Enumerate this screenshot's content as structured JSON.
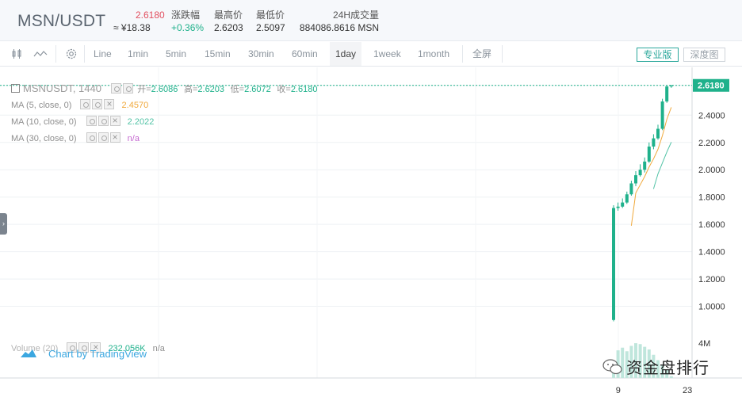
{
  "header": {
    "pair": "MSN/USDT",
    "price": "2.6180",
    "price_cny": "≈ ¥18.38",
    "change_label": "涨跌幅",
    "change_value": "+0.36%",
    "high_label": "最高价",
    "high_value": "2.6203",
    "low_label": "最低价",
    "low_value": "2.5097",
    "volume_label": "24H成交量",
    "volume_value": "884086.8616 MSN"
  },
  "toolbar": {
    "intervals": [
      "Line",
      "1min",
      "5min",
      "15min",
      "30min",
      "60min",
      "1day",
      "1week",
      "1month"
    ],
    "selected_interval": "1day",
    "fullscreen": "全屏",
    "pro_button": "专业版",
    "depth_button": "深度图"
  },
  "legend": {
    "symbol": "MSNUSDT, 1440",
    "open_label": "开=",
    "open": "2.6086",
    "high_label": "高=",
    "high": "2.6203",
    "low_label": "低=",
    "low": "2.6072",
    "close_label": "收=",
    "close": "2.6180",
    "ma5_label": "MA (5, close, 0)",
    "ma5_value": "2.4570",
    "ma10_label": "MA (10, close, 0)",
    "ma10_value": "2.2022",
    "ma30_label": "MA (30, close, 0)",
    "ma30_value": "n/a",
    "volume_label": "Volume (20)",
    "volume_value": "232.056K",
    "volume_ma": "n/a"
  },
  "colors": {
    "up": "#1fb18b",
    "down": "#e24f5f",
    "ma5": "#f0a93c",
    "ma10": "#52c3a6",
    "ma30": "#c66bd1",
    "accent": "#2aa79b"
  },
  "chart_data": {
    "type": "candlestick",
    "price_ticks": [
      "1.0000",
      "1.2000",
      "1.4000",
      "1.6000",
      "1.8000",
      "2.0000",
      "2.2000",
      "2.4000",
      "2.6180"
    ],
    "ylim": [
      0.8,
      2.75
    ],
    "x_ticks": [
      "9",
      "23"
    ],
    "volume_tick": "4M",
    "last_price": "2.6180",
    "candles": [
      {
        "o": 0.9,
        "h": 1.74,
        "l": 0.89,
        "c": 1.72
      },
      {
        "o": 1.72,
        "h": 1.76,
        "l": 1.7,
        "c": 1.73
      },
      {
        "o": 1.73,
        "h": 1.79,
        "l": 1.72,
        "c": 1.76
      },
      {
        "o": 1.76,
        "h": 1.84,
        "l": 1.75,
        "c": 1.82
      },
      {
        "o": 1.82,
        "h": 1.92,
        "l": 1.81,
        "c": 1.9
      },
      {
        "o": 1.9,
        "h": 1.99,
        "l": 1.88,
        "c": 1.96
      },
      {
        "o": 1.96,
        "h": 2.04,
        "l": 1.95,
        "c": 2.0
      },
      {
        "o": 2.0,
        "h": 2.09,
        "l": 1.98,
        "c": 2.06
      },
      {
        "o": 2.06,
        "h": 2.2,
        "l": 2.05,
        "c": 2.17
      },
      {
        "o": 2.17,
        "h": 2.26,
        "l": 2.15,
        "c": 2.23
      },
      {
        "o": 2.23,
        "h": 2.33,
        "l": 2.22,
        "c": 2.3
      },
      {
        "o": 2.3,
        "h": 2.52,
        "l": 2.29,
        "c": 2.5
      },
      {
        "o": 2.5,
        "h": 2.62,
        "l": 2.49,
        "c": 2.61
      },
      {
        "o": 2.61,
        "h": 2.62,
        "l": 2.6,
        "c": 2.618
      }
    ],
    "volumes": [
      1.2,
      3.1,
      3.4,
      3.0,
      3.6,
      3.9,
      3.8,
      3.5,
      3.2,
      2.6,
      2.0,
      1.4,
      0.9,
      0.2
    ],
    "ma5": [
      null,
      null,
      null,
      null,
      1.59,
      1.83,
      1.89,
      1.95,
      2.02,
      2.08,
      2.15,
      2.25,
      2.37,
      2.457
    ],
    "ma10": [
      null,
      null,
      null,
      null,
      null,
      null,
      null,
      null,
      null,
      1.86,
      1.97,
      2.05,
      2.13,
      2.2022
    ]
  }
}
